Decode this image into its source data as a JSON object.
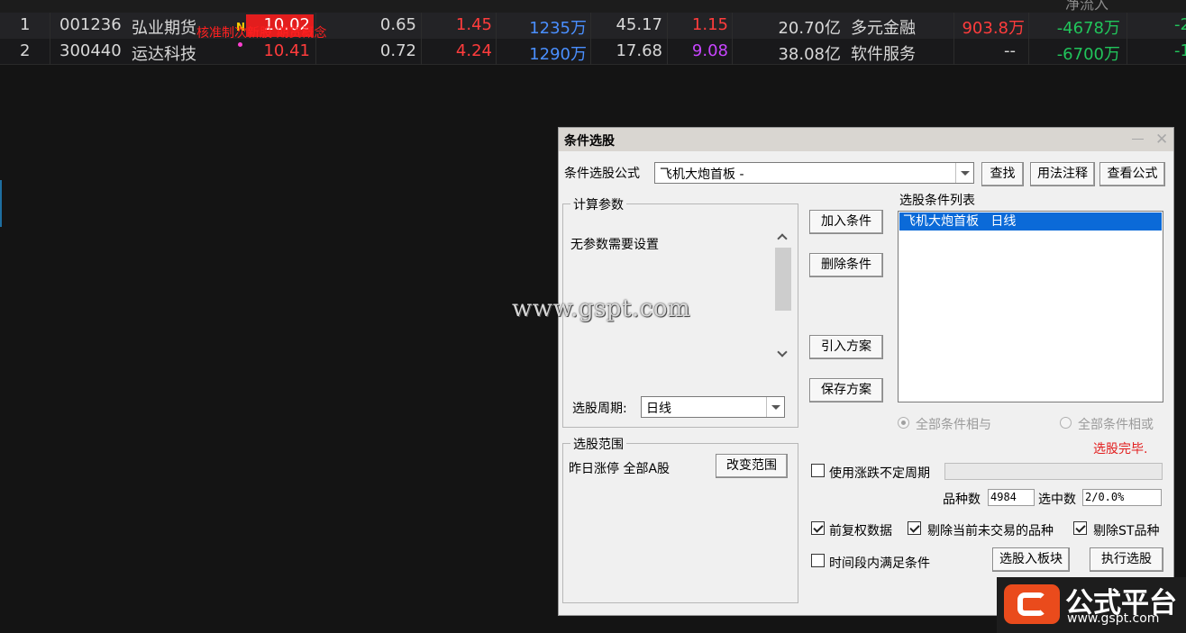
{
  "header": {
    "partial_label": "净流入"
  },
  "rows": [
    {
      "index": "1",
      "code": "001236",
      "name": "弘业期货",
      "badge": "N",
      "overlay": "核准制次新股   期货概念",
      "price": "10.02",
      "c1": "0.65",
      "c2": "1.45",
      "c3": "1235万",
      "c4": "45.17",
      "c5": "1.15",
      "c6": "20.70亿",
      "industry": "多元金融",
      "c7": "903.8万",
      "c8": "-4678万",
      "c9": "-2"
    },
    {
      "index": "2",
      "code": "300440",
      "name": "运达科技",
      "price": "10.41",
      "c1": "0.72",
      "c2": "4.24",
      "c3": "1290万",
      "c4": "17.68",
      "c5": "9.08",
      "c6": "38.08亿",
      "industry": "软件服务",
      "c7": "--",
      "c8": "-6700万",
      "c9": "-1"
    }
  ],
  "dialog": {
    "title": "条件选股",
    "formula_label": "条件选股公式",
    "formula_value": "飞机大炮首板 -",
    "find_btn": "查找",
    "usage_btn": "用法注释",
    "view_btn": "查看公式",
    "params_group": "计算参数",
    "params_text": "无参数需要设置",
    "period_label": "选股周期:",
    "period_value": "日线",
    "range_group": "选股范围",
    "range_text": "昨日涨停  全部A股",
    "change_range_btn": "改变范围",
    "add_btn": "加入条件",
    "delete_btn": "删除条件",
    "import_btn": "引入方案",
    "save_btn": "保存方案",
    "conditions_label": "选股条件列表",
    "conditions": [
      "飞机大炮首板   日线"
    ],
    "radio_and": "全部条件相与",
    "radio_or": "全部条件相或",
    "status": "选股完毕.",
    "use_uncertain_period": "使用涨跌不定周期",
    "count_label": "品种数",
    "count_value": "4984",
    "selected_label": "选中数",
    "selected_value": "2/0.0%",
    "pre_adjust": "前复权数据",
    "exclude_untraded": "剔除当前未交易的品种",
    "exclude_st": "剔除ST品种",
    "time_range": "时间段内满足条件",
    "to_block_btn": "选股入板块",
    "execute_btn": "执行选股"
  },
  "watermark": "www.gspt.com",
  "logo": {
    "name": "公式平台",
    "url": "www.gspt.com"
  },
  "colors": {
    "up": "#ff3c3c",
    "down": "#21c45b",
    "volume": "#4a8fff",
    "selection": "#0b6ad8"
  }
}
